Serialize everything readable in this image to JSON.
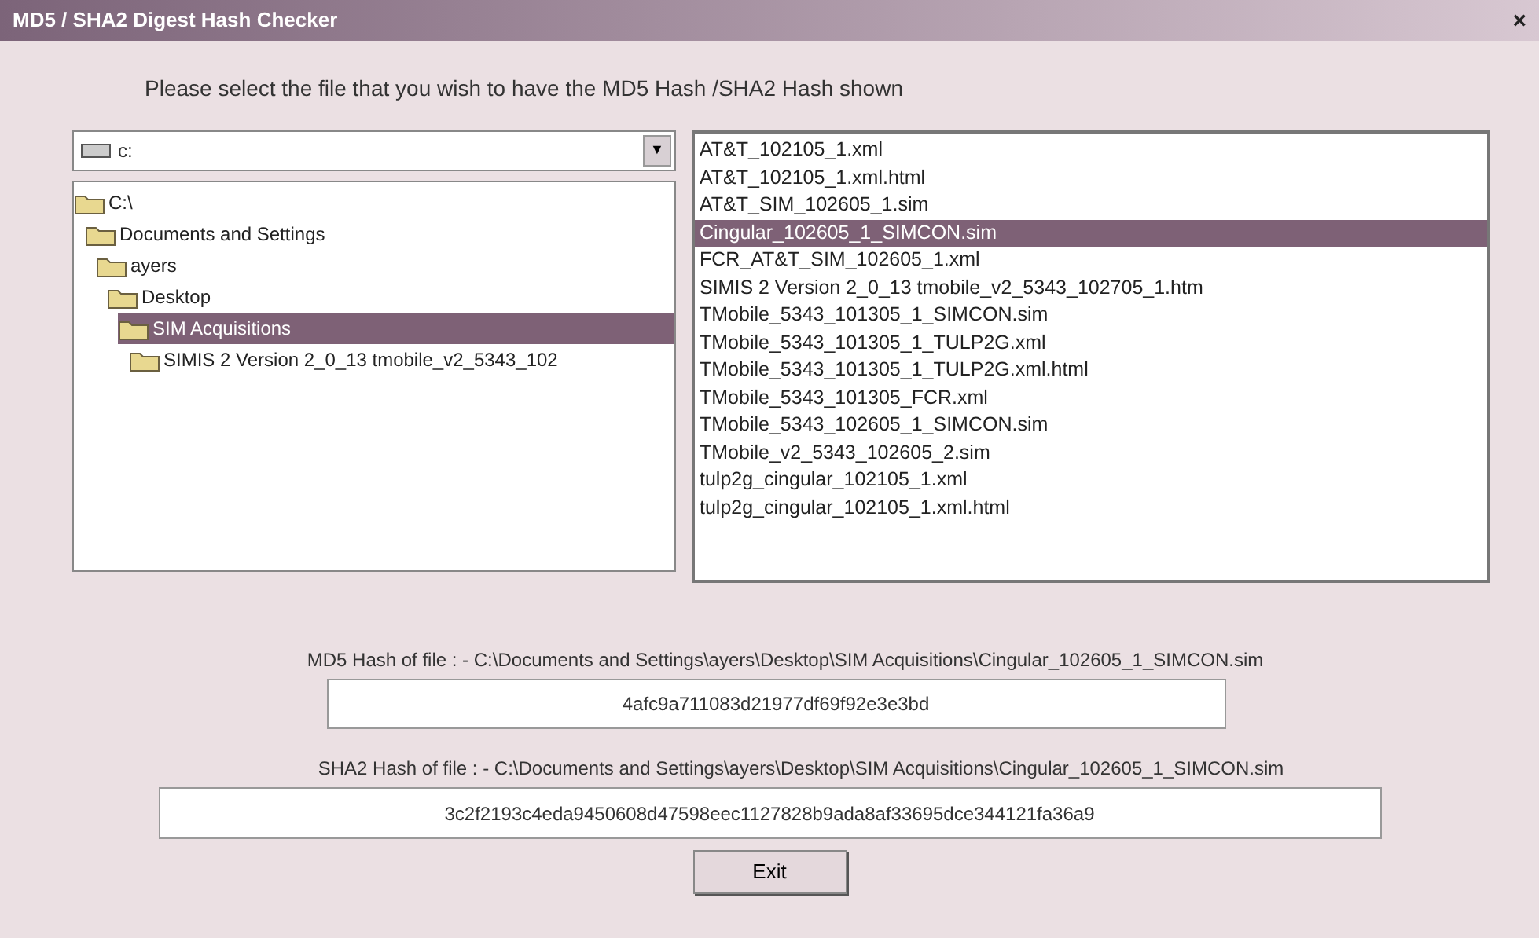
{
  "window": {
    "title": "MD5 / SHA2 Digest Hash Checker",
    "close": "×"
  },
  "instruction": "Please select the file that you wish to have the MD5 Hash /SHA2 Hash shown",
  "drive": {
    "value": "c:",
    "arrow": "▼"
  },
  "folders": [
    {
      "label": "C:\\",
      "selected": false,
      "children": [
        {
          "label": "Documents and Settings",
          "selected": false,
          "children": [
            {
              "label": "ayers",
              "selected": false,
              "children": [
                {
                  "label": "Desktop",
                  "selected": false,
                  "children": [
                    {
                      "label": "SIM Acquisitions",
                      "selected": true,
                      "children": [
                        {
                          "label": "SIMIS 2 Version 2_0_13 tmobile_v2_5343_102",
                          "selected": false
                        }
                      ]
                    }
                  ]
                }
              ]
            }
          ]
        }
      ]
    }
  ],
  "files": [
    {
      "label": "AT&T_102105_1.xml",
      "selected": false
    },
    {
      "label": "AT&T_102105_1.xml.html",
      "selected": false
    },
    {
      "label": "AT&T_SIM_102605_1.sim",
      "selected": false
    },
    {
      "label": "Cingular_102605_1_SIMCON.sim",
      "selected": true
    },
    {
      "label": "FCR_AT&T_SIM_102605_1.xml",
      "selected": false
    },
    {
      "label": "SIMIS 2 Version 2_0_13 tmobile_v2_5343_102705_1.htm",
      "selected": false
    },
    {
      "label": "TMobile_5343_101305_1_SIMCON.sim",
      "selected": false
    },
    {
      "label": "TMobile_5343_101305_1_TULP2G.xml",
      "selected": false
    },
    {
      "label": "TMobile_5343_101305_1_TULP2G.xml.html",
      "selected": false
    },
    {
      "label": "TMobile_5343_101305_FCR.xml",
      "selected": false
    },
    {
      "label": "TMobile_5343_102605_1_SIMCON.sim",
      "selected": false
    },
    {
      "label": "TMobile_v2_5343_102605_2.sim",
      "selected": false
    },
    {
      "label": "tulp2g_cingular_102105_1.xml",
      "selected": false
    },
    {
      "label": "tulp2g_cingular_102105_1.xml.html",
      "selected": false
    }
  ],
  "md5": {
    "label": "MD5 Hash of file : - C:\\Documents and Settings\\ayers\\Desktop\\SIM Acquisitions\\Cingular_102605_1_SIMCON.sim",
    "value": "4afc9a711083d21977df69f92e3e3bd"
  },
  "sha2": {
    "label": "SHA2 Hash of file : - C:\\Documents and Settings\\ayers\\Desktop\\SIM Acquisitions\\Cingular_102605_1_SIMCON.sim",
    "value": "3c2f2193c4eda9450608d47598eec1127828b9ada8af33695dce344121fa36a9"
  },
  "exit_button": "Exit"
}
